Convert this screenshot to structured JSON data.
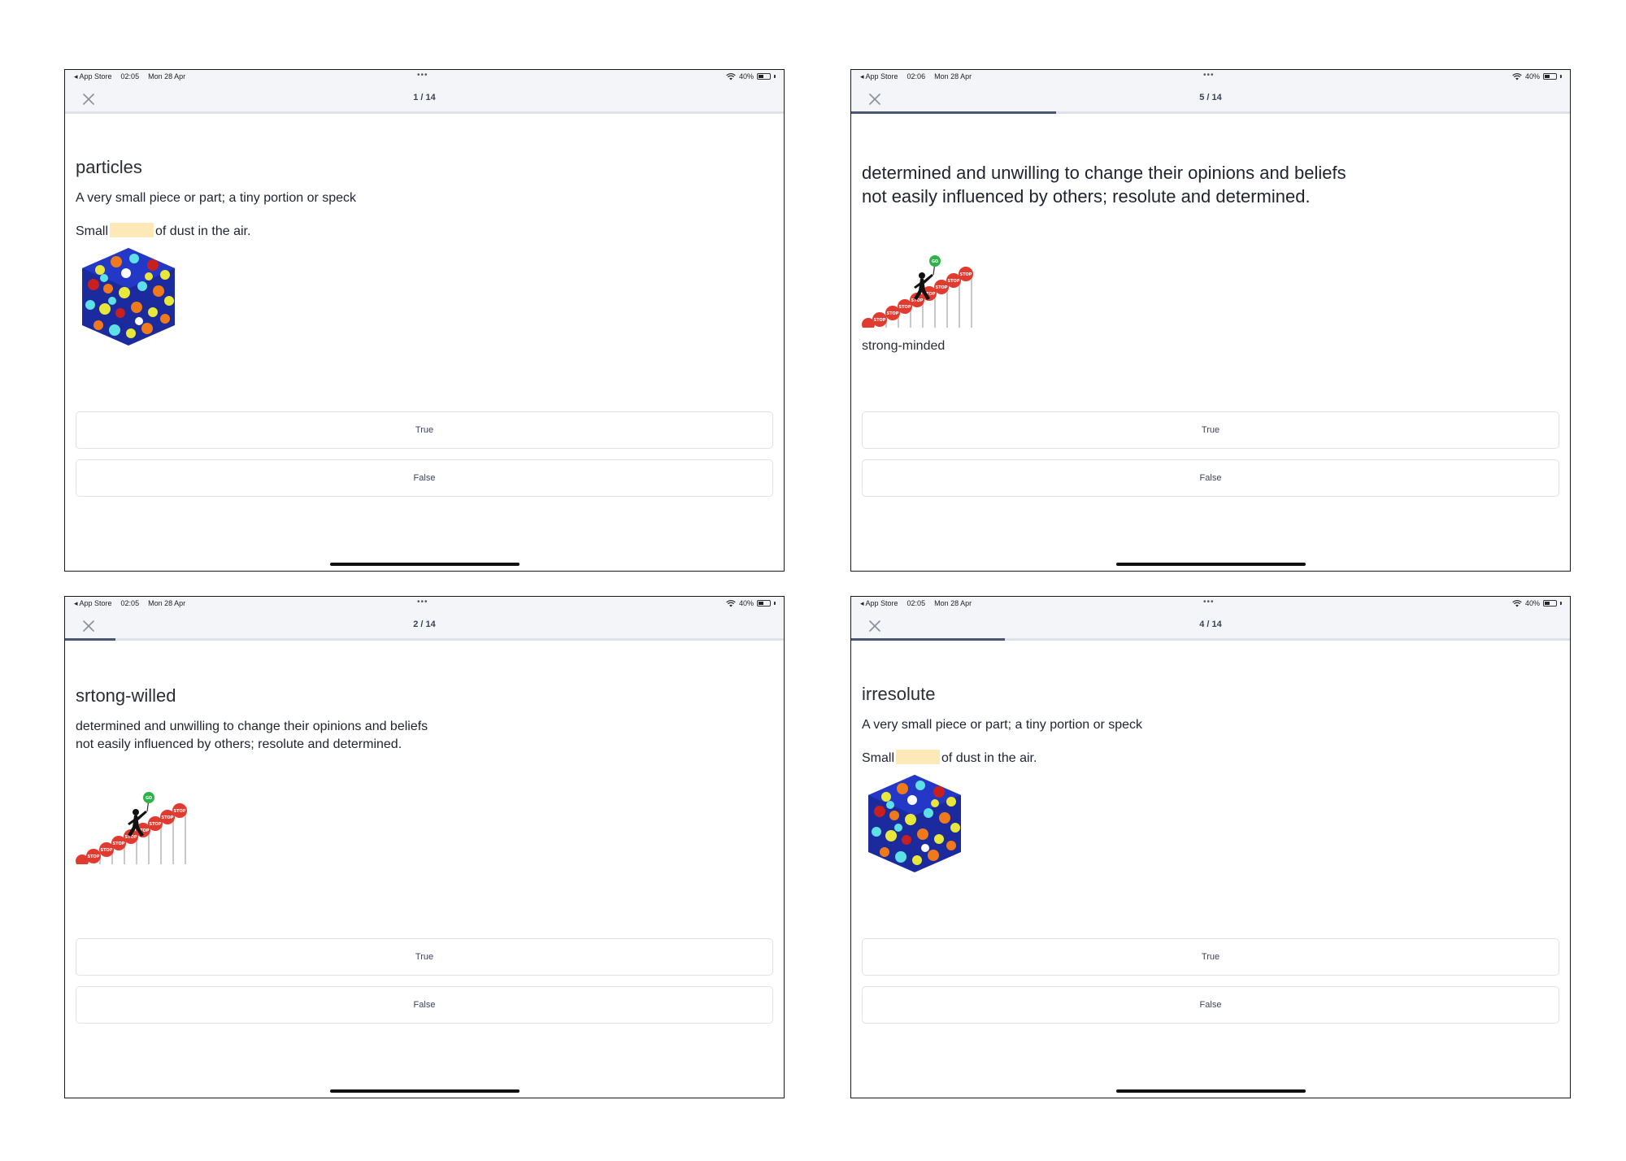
{
  "screens": [
    {
      "id": "s1",
      "status": {
        "carrier": "◂ App Store",
        "time": "02:05",
        "date": "Mon 28 Apr",
        "dots": "•••",
        "battery": "40%"
      },
      "progress": {
        "label": "1 / 14",
        "current": 1,
        "total": 14,
        "fraction": 0.0
      },
      "term": "particles",
      "definition": "A very small piece or part; a tiny portion or speck",
      "example": {
        "before": "Small",
        "after": "of dust in the air."
      },
      "image": "particle-cube-image",
      "choices": {
        "true_label": "True",
        "false_label": "False"
      }
    },
    {
      "id": "s2",
      "status": {
        "carrier": "◂ App Store",
        "time": "02:06",
        "date": "Mon 28 Apr",
        "dots": "•••",
        "battery": "40%"
      },
      "progress": {
        "label": "5 / 14",
        "current": 5,
        "total": 14,
        "fraction": 0.285
      },
      "definition": "determined and unwilling to change their opinions and beliefs\nnot easily influenced by others; resolute and determined.",
      "image": "stop-signs-climber-image",
      "answer_word": "strong-minded",
      "choices": {
        "true_label": "True",
        "false_label": "False"
      }
    },
    {
      "id": "s3",
      "status": {
        "carrier": "◂ App Store",
        "time": "02:05",
        "date": "Mon 28 Apr",
        "dots": "•••",
        "battery": "40%"
      },
      "progress": {
        "label": "2 / 14",
        "current": 2,
        "total": 14,
        "fraction": 0.07
      },
      "term": "srtong-willed",
      "definition": "determined and unwilling to change their opinions and beliefs\nnot easily influenced by others; resolute and determined.",
      "image": "stop-signs-climber-image",
      "choices": {
        "true_label": "True",
        "false_label": "False"
      }
    },
    {
      "id": "s4",
      "status": {
        "carrier": "◂ App Store",
        "time": "02:05",
        "date": "Mon 28 Apr",
        "dots": "•••",
        "battery": "40%"
      },
      "progress": {
        "label": "4 / 14",
        "current": 4,
        "total": 14,
        "fraction": 0.214
      },
      "term": "irresolute",
      "definition": "A very small piece or part; a tiny portion or speck",
      "example": {
        "before": "Small",
        "after": "of dust in the air."
      },
      "image": "particle-cube-image",
      "choices": {
        "true_label": "True",
        "false_label": "False"
      }
    }
  ],
  "colors": {
    "progress_fill": "#4b5575",
    "progress_track": "#dfe2ea",
    "blank_highlight": "#fde9b8",
    "navbar_bg": "#f4f5f8"
  }
}
